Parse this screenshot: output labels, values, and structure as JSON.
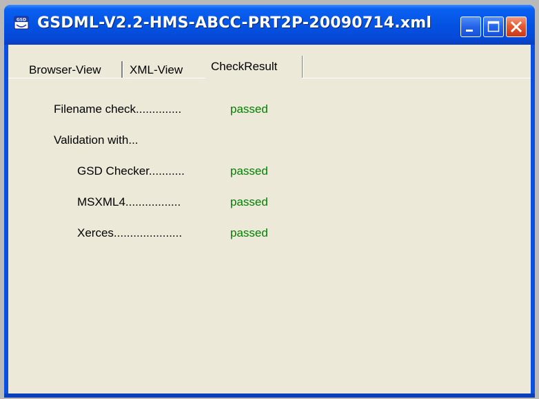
{
  "window": {
    "title": "GSDML-V2.2-HMS-ABCC-PRT2P-20090714.xml",
    "app_icon_label": "GSD"
  },
  "titlebar_buttons": {
    "minimize": "minimize-icon",
    "maximize": "maximize-icon",
    "close": "close-icon"
  },
  "tabs": [
    {
      "label": "Browser-View",
      "active": false
    },
    {
      "label": "XML-View",
      "active": false
    },
    {
      "label": "CheckResult",
      "active": true
    }
  ],
  "check_results": {
    "filename_check": {
      "label": "Filename check..............",
      "status": "passed"
    },
    "validation_heading": "Validation with...",
    "gsd_checker": {
      "label": "GSD Checker...........",
      "status": "passed"
    },
    "msxml4": {
      "label": "MSXML4.................",
      "status": "passed"
    },
    "xerces": {
      "label": "Xerces.....................",
      "status": "passed"
    }
  },
  "colors": {
    "titlebar": "#0553e3",
    "client_background": "#ece9d8",
    "passed": "#008000",
    "close_button": "#e45a31"
  }
}
